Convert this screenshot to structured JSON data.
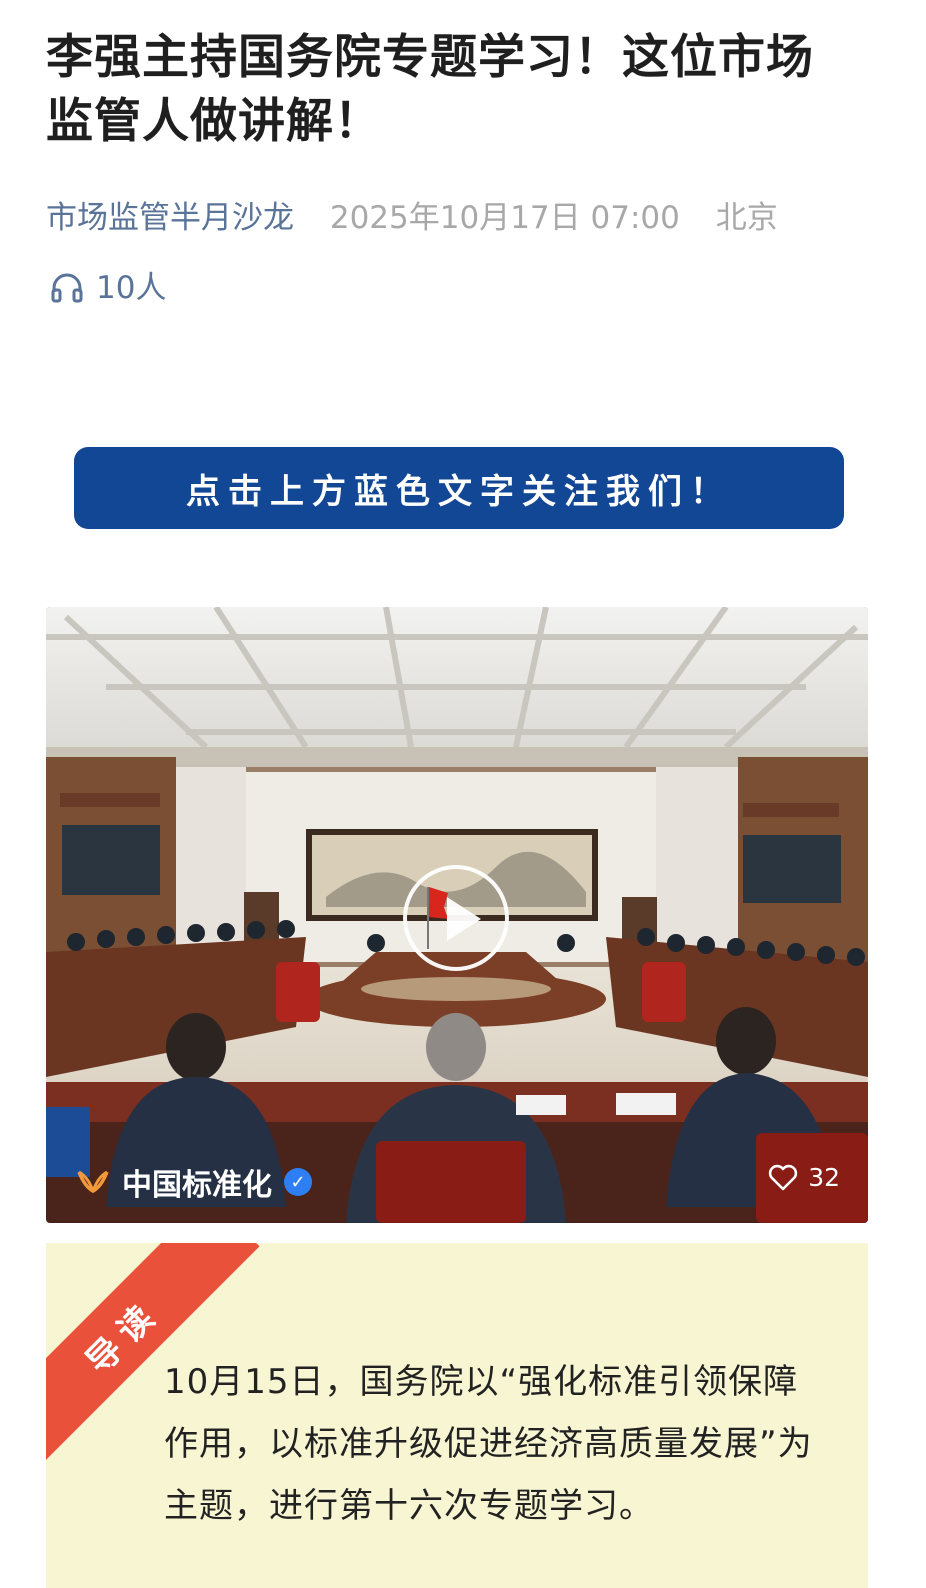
{
  "article": {
    "title": "李强主持国务院专题学习！这位市场监管人做讲解！",
    "account_name": "市场监管半月沙龙",
    "publish_time": "2025年10月17日 07:00",
    "location": "北京",
    "listen_count": "10人",
    "listen_icon": "headphones-icon"
  },
  "follow_banner": {
    "text": "点击上方蓝色文字关注我们！",
    "color": "#124796"
  },
  "video": {
    "channel_name": "中国标准化",
    "verified_icon": "verified-check-icon",
    "likes": "32",
    "like_icon": "heart-icon",
    "play_icon": "play-icon"
  },
  "intro": {
    "ribbon_label": "导读",
    "text": "10月15日，国务院以“强化标准引领保障作用，以标准升级促进经济高质量发展”为主题，进行第十六次专题学习。",
    "ribbon_color": "#e9513a",
    "background_color": "#f8f6d2"
  }
}
